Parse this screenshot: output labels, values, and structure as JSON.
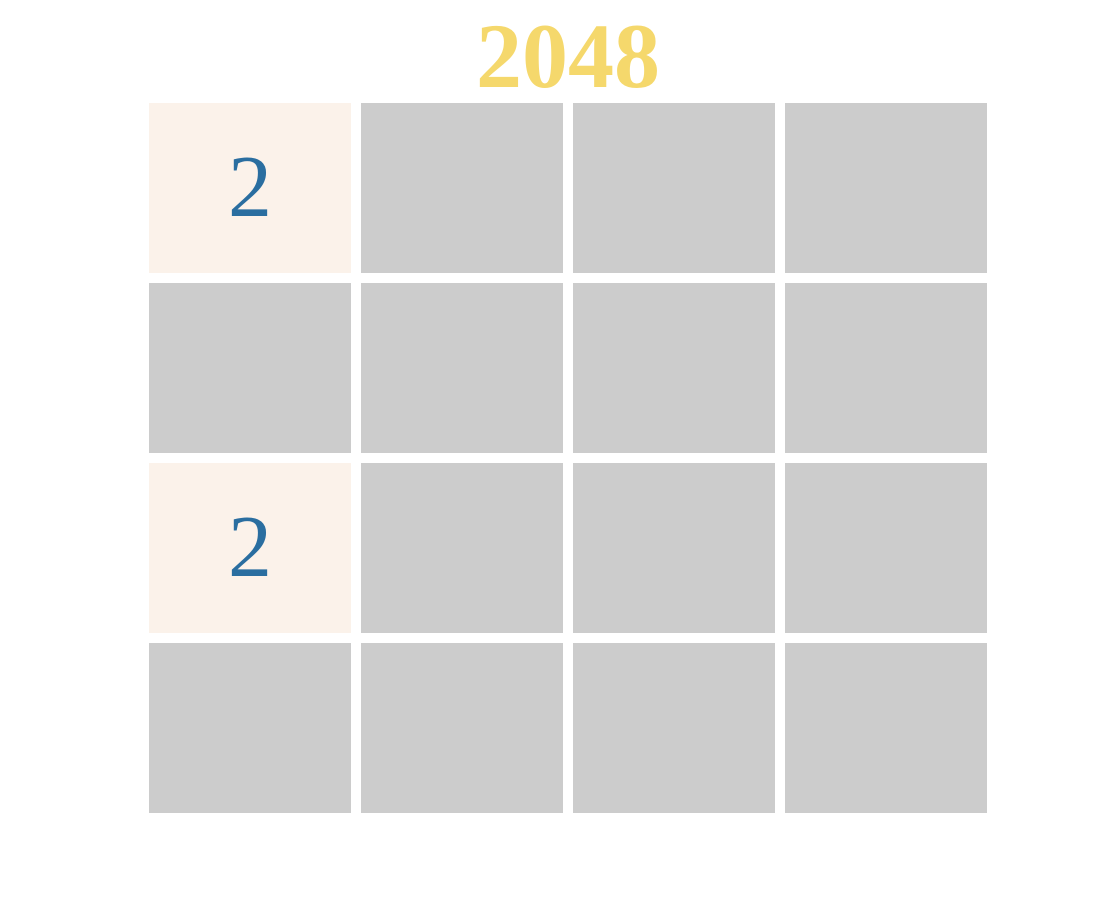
{
  "game": {
    "title": "2048",
    "title_color": "#f5d86c",
    "empty_cell_color": "#cccccc",
    "tile_colors": {
      "2": {
        "background": "#fbf2ea",
        "text": "#2a6ea0"
      }
    },
    "grid": [
      [
        2,
        0,
        0,
        0
      ],
      [
        0,
        0,
        0,
        0
      ],
      [
        2,
        0,
        0,
        0
      ],
      [
        0,
        0,
        0,
        0
      ]
    ]
  }
}
